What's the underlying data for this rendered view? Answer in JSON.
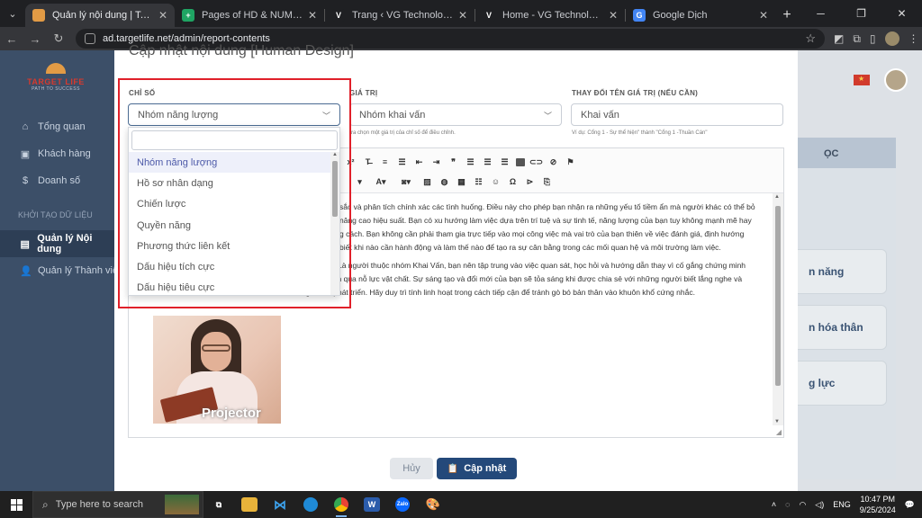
{
  "browser": {
    "tabs": [
      {
        "title": "Quản lý nội dung | Target Life",
        "fav_color": "#e29b45",
        "fav_text": "",
        "active": true
      },
      {
        "title": "Pages of HD & NUM web - Goo",
        "fav_color": "#1fa463",
        "fav_text": "+",
        "active": false
      },
      {
        "title": "Trang ‹ VG Technology — Word",
        "fav_color": "#1f2023",
        "fav_text": "V",
        "active": false
      },
      {
        "title": "Home - VG Technology",
        "fav_color": "#1f2023",
        "fav_text": "V",
        "active": false
      },
      {
        "title": "Google Dịch",
        "fav_color": "#4285f4",
        "fav_text": "G",
        "active": false
      }
    ],
    "url": "ad.targetlife.net/admin/report-contents"
  },
  "sidebar": {
    "brand": "TARGET LIFE",
    "slogan": "PATH TO SUCCESS",
    "items": [
      {
        "label": "Tổng quan",
        "icon": "⌂"
      },
      {
        "label": "Khách hàng",
        "icon": "▣"
      },
      {
        "label": "Doanh số",
        "icon": "$"
      }
    ],
    "group_label": "KHỞI TẠO DỮ LIỆU",
    "group_items": [
      {
        "label": "Quản lý Nội dung",
        "icon": "▤",
        "active": true
      },
      {
        "label": "Quản lý Thành viên",
        "icon": "👤",
        "active": false
      }
    ]
  },
  "background": {
    "right_panel_header": "ỌC",
    "right_cards": [
      "n năng",
      "n hóa thân",
      "g lực"
    ]
  },
  "modal": {
    "title": "Cập nhật nội dung [Human Design]",
    "index_label": "CHỈ SỐ",
    "index_value": "Nhóm năng lượng",
    "value_label": "GIÁ TRỊ",
    "value_value": "Nhóm khai vấn",
    "value_hint": "ựa chọn một giá trị của chỉ số để điều chỉnh.",
    "rename_label": "THAY ĐỔI TÊN GIÁ TRỊ (NẾU CẦN)",
    "rename_value": "Khai vấn",
    "rename_hint": "Ví dụ: Cổng 1 - Sự thể hiện\" thành \"Cổng 1 -Thuần Cán\"",
    "editor": {
      "para1_lines": [
        "sắc và phân tích chính xác các tình huống. Điều này cho phép bạn nhận ra những yếu tố tiềm ẩn mà người khác có thể bỏ",
        "nâng cao hiệu suất. Bạn có xu hướng làm việc dựa trên trí tuệ và sự tinh tế, năng lượng của bạn tuy không mạnh mẽ hay",
        "g cách. Bạn không cần phải tham gia trực tiếp vào mọi công việc mà vai trò của bạn thiên về việc đánh giá, định hướng",
        "biết khi nào cần hành động và làm thế nào để tạo ra sự cân bằng trong các mối quan hệ và môi trường làm việc."
      ],
      "para2_lines": [
        "Khuyến nghị: Là người thuộc nhóm Khai Vấn, bạn nên tập trung vào việc quan sát, học hỏi và hướng dẫn thay vì cố gắng chứng minh",
        "giá trị  bản thân qua nỗ lực vật chất. Sự sáng tạo và đổi mới của bạn sẽ tỏa sáng khi được chia sẻ với những người biết lắng nghe và",
        "mong muốn phát triển. Hãy duy trì tính linh hoạt trong cách tiếp cận để tránh gò bó bản thân vào khuôn khổ cứng nhắc."
      ],
      "image_caption": "Projector"
    },
    "cancel_label": "Hủy",
    "update_label": "Cập nhật"
  },
  "dropdown": {
    "options": [
      "Nhóm năng lượng",
      "Hồ sơ nhân dạng",
      "Chiến lược",
      "Quyền năng",
      "Phương thức liên kết",
      "Dấu hiệu tích cực",
      "Dấu hiệu tiêu cực"
    ],
    "selected_index": 0
  },
  "taskbar": {
    "search_placeholder": "Type here to search",
    "lang": "ENG",
    "time": "10:47 PM",
    "date": "9/25/2024"
  },
  "colors": {
    "accent": "#24497a",
    "sidebar_bg": "#3c4f68",
    "highlight": "#e0202a",
    "selected_option_text": "#4c59a8"
  }
}
